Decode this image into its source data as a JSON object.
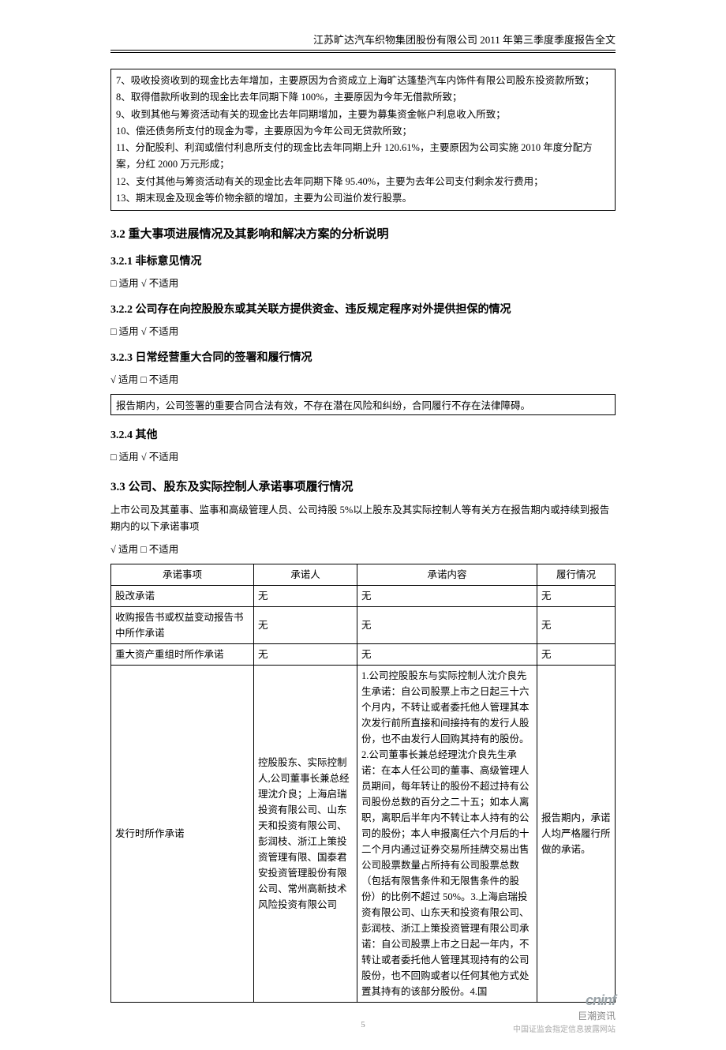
{
  "header": {
    "title": "江苏旷达汽车织物集团股份有限公司 2011 年第三季度季度报告全文"
  },
  "topBox": {
    "line7": "7、吸收投资收到的现金比去年增加，主要原因为合资成立上海旷达篷垫汽车内饰件有限公司股东投资款所致；",
    "line8": "8、取得借款所收到的现金比去年同期下降 100%，主要原因为今年无借款所致；",
    "line9": "9、收到其他与筹资活动有关的现金比去年同期增加，主要为募集资金帐户利息收入所致；",
    "line10": "10、偿还债务所支付的现金为零，主要原因为今年公司无贷款所致；",
    "line11": "11、分配股利、利润或偿付利息所支付的现金比去年同期上升 120.61%，主要原因为公司实施 2010 年度分配方案，分红 2000 万元形成；",
    "line12": "12、支付其他与筹资活动有关的现金比去年同期下降 95.40%，主要为去年公司支付剩余发行费用；",
    "line13": "13、期末现金及现金等价物余额的增加，主要为公司溢价发行股票。"
  },
  "s32": {
    "title": "3.2 重大事项进展情况及其影响和解决方案的分析说明"
  },
  "s321": {
    "title": "3.2.1 非标意见情况",
    "apply": "□ 适用 √ 不适用"
  },
  "s322": {
    "title": "3.2.2 公司存在向控股股东或其关联方提供资金、违反规定程序对外提供担保的情况",
    "apply": "□ 适用 √ 不适用"
  },
  "s323": {
    "title": "3.2.3 日常经营重大合同的签署和履行情况",
    "apply": "√ 适用 □ 不适用",
    "box": "报告期内，公司签署的重要合同合法有效，不存在潜在风险和纠纷，合同履行不存在法律障碍。"
  },
  "s324": {
    "title": "3.2.4 其他",
    "apply": "□ 适用 √ 不适用"
  },
  "s33": {
    "title": "3.3 公司、股东及实际控制人承诺事项履行情况",
    "intro": "上市公司及其董事、监事和高级管理人员、公司持股 5%以上股东及其实际控制人等有关方在报告期内或持续到报告期内的以下承诺事项",
    "apply": "√ 适用 □ 不适用"
  },
  "table": {
    "headers": {
      "item": "承诺事项",
      "person": "承诺人",
      "content": "承诺内容",
      "status": "履行情况"
    },
    "rows": [
      {
        "item": "股改承诺",
        "person": "无",
        "content": "无",
        "status": "无"
      },
      {
        "item": "收购报告书或权益变动报告书中所作承诺",
        "person": "无",
        "content": "无",
        "status": "无"
      },
      {
        "item": "重大资产重组时所作承诺",
        "person": "无",
        "content": "无",
        "status": "无"
      },
      {
        "item": "发行时所作承诺",
        "person": "控股股东、实际控制人,公司董事长兼总经理沈介良；上海启瑞投资有限公司、山东天和投资有限公司、彭润枝、浙江上策投资管理有限、国泰君安投资管理股份有限公司、常州高新技术风险投资有限公司",
        "content": "1.公司控股股东与实际控制人沈介良先生承诺：自公司股票上市之日起三十六个月内，不转让或者委托他人管理其本次发行前所直接和间接持有的发行人股份，也不由发行人回购其持有的股份。2.公司董事长兼总经理沈介良先生承诺：在本人任公司的董事、高级管理人员期间，每年转让的股份不超过持有公司股份总数的百分之二十五；如本人离职，离职后半年内不转让本人持有的公司的股份；本人申报离任六个月后的十二个月内通过证券交易所挂牌交易出售公司股票数量占所持有公司股票总数（包括有限售条件和无限售条件的股份）的比例不超过 50%。3.上海启瑞投资有限公司、山东天和投资有限公司、彭润枝、浙江上策投资管理有限公司承诺：自公司股票上市之日起一年内，不转让或者委托他人管理其现持有的公司股份，也不回购或者以任何其他方式处置其持有的该部分股份。4.国",
        "status": "报告期内，承诺人均严格履行所做的承诺。"
      }
    ]
  },
  "footer": {
    "logo": "cninf",
    "brand": "巨潮资讯",
    "sub": "中国证监会指定信息披露网站"
  },
  "pageNumber": "5"
}
